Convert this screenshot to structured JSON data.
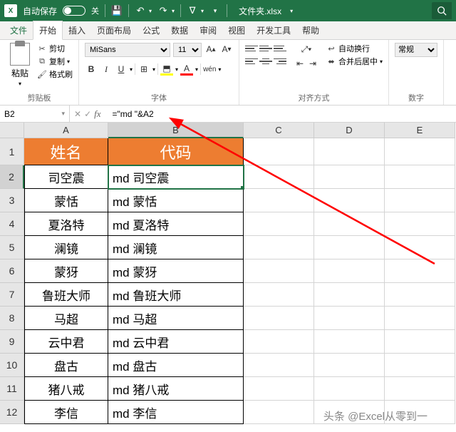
{
  "titlebar": {
    "autosave": "自动保存",
    "autosave_state": "关",
    "filename": "文件夹.xlsx"
  },
  "tabs": [
    "文件",
    "开始",
    "插入",
    "页面布局",
    "公式",
    "数据",
    "审阅",
    "视图",
    "开发工具",
    "帮助"
  ],
  "active_tab": 1,
  "ribbon": {
    "clipboard": {
      "paste": "粘贴",
      "cut": "剪切",
      "copy": "复制",
      "format_painter": "格式刷",
      "label": "剪贴板"
    },
    "font": {
      "name": "MiSans",
      "size": "11",
      "label": "字体"
    },
    "align": {
      "wrap": "自动换行",
      "merge": "合并后居中",
      "label": "对齐方式"
    },
    "number": {
      "category": "常规",
      "label": "数字"
    }
  },
  "namebox": "B2",
  "formula": "=\"md \"&A2",
  "columns": [
    "A",
    "B",
    "C",
    "D",
    "E"
  ],
  "col_widths": {
    "A": 118,
    "B": 190,
    "C": 99,
    "D": 99,
    "E": 99
  },
  "header_row": {
    "A": "姓名",
    "B": "代码"
  },
  "rows": [
    {
      "n": 2,
      "A": "司空震",
      "B": "md 司空震"
    },
    {
      "n": 3,
      "A": "蒙恬",
      "B": "md 蒙恬"
    },
    {
      "n": 4,
      "A": "夏洛特",
      "B": "md 夏洛特"
    },
    {
      "n": 5,
      "A": "澜镜",
      "B": "md 澜镜"
    },
    {
      "n": 6,
      "A": "蒙犽",
      "B": "md 蒙犽"
    },
    {
      "n": 7,
      "A": "鲁班大师",
      "B": "md 鲁班大师"
    },
    {
      "n": 8,
      "A": "马超",
      "B": "md 马超"
    },
    {
      "n": 9,
      "A": "云中君",
      "B": "md 云中君"
    },
    {
      "n": 10,
      "A": "盘古",
      "B": "md 盘古"
    },
    {
      "n": 11,
      "A": "猪八戒",
      "B": "md 猪八戒"
    },
    {
      "n": 12,
      "A": "李信",
      "B": "md 李信"
    }
  ],
  "selected_cell": "B2",
  "watermark": "头条 @Excel从零到一"
}
